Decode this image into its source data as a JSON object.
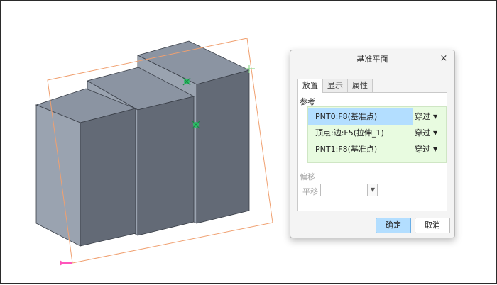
{
  "dialog": {
    "title": "基准平面",
    "close_glyph": "×",
    "tabs": [
      {
        "label": "放置",
        "active": true
      },
      {
        "label": "显示",
        "active": false
      },
      {
        "label": "属性",
        "active": false
      }
    ],
    "references_label": "参考",
    "references": [
      {
        "name": "PNT0:F8(基准点)",
        "type": "穿过",
        "selected": true
      },
      {
        "name": "顶点:边:F5(拉伸_1)",
        "type": "穿过",
        "selected": false
      },
      {
        "name": "PNT1:F8(基准点)",
        "type": "穿过",
        "selected": false
      }
    ],
    "offset_label": "偏移",
    "translate_label": "平移",
    "translate_value": "",
    "ok_label": "确定",
    "cancel_label": "取消"
  },
  "colors": {
    "solid_front": "#636a76",
    "solid_side": "#9aa3b0",
    "solid_top": "#8b94a2",
    "plane_outline": "#f0a070",
    "datum_point": "#2ec26a",
    "csys_marker": "#ff55bb",
    "selected_row": "#b3deff",
    "ref_box": "#e8fbe0"
  }
}
